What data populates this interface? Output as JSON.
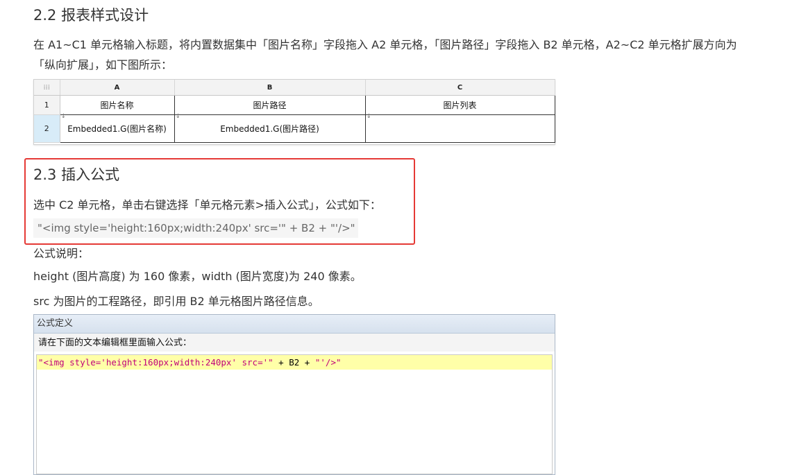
{
  "section_22": {
    "heading": "2.2 报表样式设计",
    "para_line1": "在 A1~C1 单元格输入标题，将内置数据集中「图片名称」字段拖入 A2 单元格，「图片路径」字段拖入 B2 单元格，A2~C2 单元格扩展方向为",
    "para_line2": "「纵向扩展」，如下图所示："
  },
  "sheet": {
    "corner_icon": "grid-icon",
    "columns": [
      "A",
      "B",
      "C"
    ],
    "rows": [
      {
        "num": "1",
        "cells": [
          "图片名称",
          "图片路径",
          "图片列表"
        ]
      },
      {
        "num": "2",
        "cells": [
          "Embedded1.G(图片名称)",
          "Embedded1.G(图片路径)",
          ""
        ]
      }
    ],
    "expand_arrow": "↓"
  },
  "section_23": {
    "heading": "2.3 插入公式",
    "para": "选中 C2 单元格，单击右键选择「单元格元素>插入公式」，公式如下：",
    "code": "\"<img style='height:160px;width:240px' src='\" + B2 + \"'/>\"",
    "highlight_color": "#e53935"
  },
  "notes": {
    "label": "公式说明：",
    "line1": "height (图片高度) 为 160 像素，width (图片宽度)为 240 像素。",
    "line2": "src 为图片的工程路径，即引用 B2 单元格图片路径信息。"
  },
  "dialog": {
    "title": "公式定义",
    "prompt": "请在下面的文本编辑框里面输入公式：",
    "str1": "\"<img style='height:160px;width:240px' src='\"",
    "op1": " + B2 + ",
    "str2": "\"'/>\""
  }
}
